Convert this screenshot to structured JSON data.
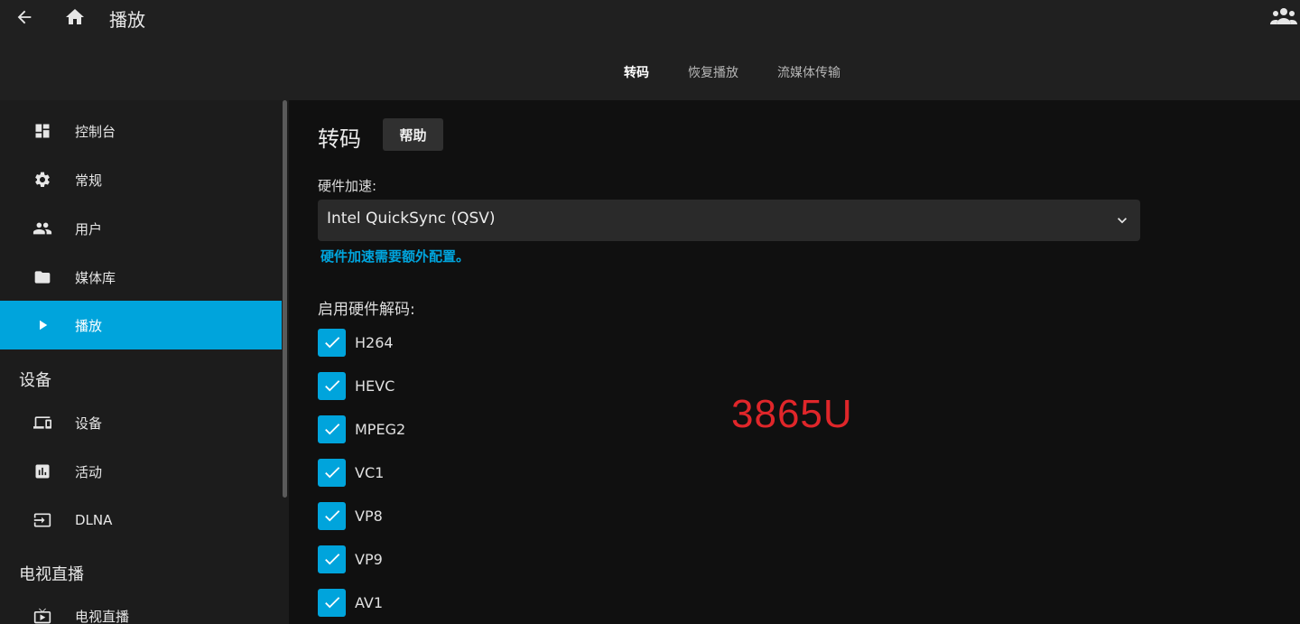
{
  "header": {
    "title": "播放",
    "icons": {
      "back": "arrow-back-icon",
      "home": "home-icon",
      "users": "users-icon"
    }
  },
  "tabs": [
    {
      "label": "转码",
      "active": true
    },
    {
      "label": "恢复播放",
      "active": false
    },
    {
      "label": "流媒体传输",
      "active": false
    }
  ],
  "sidebar": {
    "items": [
      {
        "label": "控制台",
        "icon": "dashboard-icon"
      },
      {
        "label": "常规",
        "icon": "gear-icon"
      },
      {
        "label": "用户",
        "icon": "users-icon"
      },
      {
        "label": "媒体库",
        "icon": "folder-icon"
      },
      {
        "label": "播放",
        "icon": "play-icon",
        "active": true
      }
    ],
    "sections": [
      {
        "title": "设备",
        "items": [
          {
            "label": "设备",
            "icon": "devices-icon"
          },
          {
            "label": "活动",
            "icon": "chart-icon"
          },
          {
            "label": "DLNA",
            "icon": "input-icon"
          }
        ]
      },
      {
        "title": "电视直播",
        "items": [
          {
            "label": "电视直播",
            "icon": "tv-icon"
          }
        ]
      }
    ]
  },
  "main": {
    "title": "转码",
    "help_label": "帮助",
    "hw_accel_label": "硬件加速:",
    "hw_accel_value": "Intel QuickSync (QSV)",
    "hw_accel_link": "硬件加速需要额外配置。",
    "decode_label": "启用硬件解码:",
    "codecs": [
      {
        "label": "H264",
        "checked": true
      },
      {
        "label": "HEVC",
        "checked": true
      },
      {
        "label": "MPEG2",
        "checked": true
      },
      {
        "label": "VC1",
        "checked": true
      },
      {
        "label": "VP8",
        "checked": true
      },
      {
        "label": "VP9",
        "checked": true
      },
      {
        "label": "AV1",
        "checked": true
      }
    ]
  },
  "overlay_text": "3865U",
  "colors": {
    "accent": "#00a4dc",
    "overlay": "#e0262a",
    "header_bg": "#202020",
    "sidebar_bg": "#1c1c1c",
    "main_bg": "#101010"
  }
}
